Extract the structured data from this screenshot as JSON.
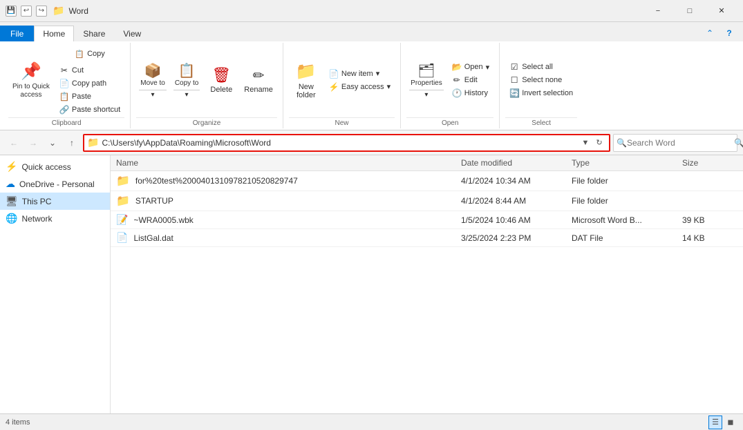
{
  "titleBar": {
    "title": "Word",
    "icons": [
      "save-icon",
      "undo-icon",
      "redo-icon"
    ],
    "controls": [
      "minimize",
      "maximize",
      "close"
    ]
  },
  "ribbon": {
    "tabs": [
      "File",
      "Home",
      "Share",
      "View"
    ],
    "activeTab": "Home",
    "groups": {
      "clipboard": {
        "label": "Clipboard",
        "buttons": {
          "pinQuickAccess": "Pin to Quick\naccess",
          "cut": "Cut",
          "copy": "Copy",
          "copyPath": "Copy path",
          "paste": "Paste",
          "pasteShortcut": "Paste shortcut"
        }
      },
      "organize": {
        "label": "Organize",
        "buttons": {
          "moveTo": "Move to",
          "copyTo": "Copy to",
          "delete": "Delete",
          "rename": "Rename",
          "newFolder": "New\nfolder"
        }
      },
      "new": {
        "label": "New",
        "buttons": {
          "newItem": "New item",
          "easyAccess": "Easy access"
        }
      },
      "open": {
        "label": "Open",
        "buttons": {
          "openBtn": "Open",
          "editBtn": "Edit",
          "history": "History",
          "properties": "Properties"
        }
      },
      "select": {
        "label": "Select",
        "buttons": {
          "selectAll": "Select all",
          "selectNone": "Select none",
          "invertSelection": "Invert selection"
        }
      }
    }
  },
  "navBar": {
    "addressPath": "C:\\Users\\fy\\AppData\\Roaming\\Microsoft\\Word",
    "searchPlaceholder": "Search Word"
  },
  "sidebar": {
    "items": [
      {
        "label": "Quick access",
        "icon": "⚡",
        "type": "quick"
      },
      {
        "label": "OneDrive - Personal",
        "icon": "☁",
        "type": "onedrive"
      },
      {
        "label": "This PC",
        "icon": "💻",
        "type": "thispc",
        "selected": true
      },
      {
        "label": "Network",
        "icon": "🌐",
        "type": "network"
      }
    ]
  },
  "fileList": {
    "columns": {
      "name": "Name",
      "dateModified": "Date modified",
      "type": "Type",
      "size": "Size"
    },
    "files": [
      {
        "name": "for%20test%2000401310978210520829747",
        "dateModified": "4/1/2024 10:34 AM",
        "type": "File folder",
        "size": "",
        "iconType": "folder"
      },
      {
        "name": "STARTUP",
        "dateModified": "4/1/2024 8:44 AM",
        "type": "File folder",
        "size": "",
        "iconType": "folder"
      },
      {
        "name": "~WRA0005.wbk",
        "dateModified": "1/5/2024 10:46 AM",
        "type": "Microsoft Word B...",
        "size": "39 KB",
        "iconType": "wbk"
      },
      {
        "name": "ListGal.dat",
        "dateModified": "3/25/2024 2:23 PM",
        "type": "DAT File",
        "size": "14 KB",
        "iconType": "dat"
      }
    ]
  },
  "statusBar": {
    "itemCount": "4 items"
  }
}
